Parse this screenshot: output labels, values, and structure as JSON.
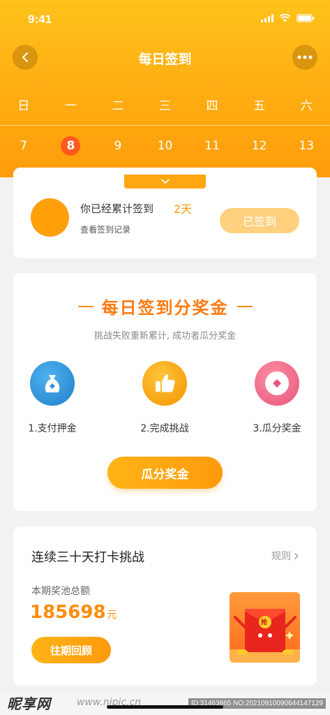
{
  "status_bar": {
    "time": "9:41"
  },
  "header": {
    "title": "每日签到",
    "weekdays": [
      "日",
      "一",
      "二",
      "三",
      "四",
      "五",
      "六"
    ],
    "dates": [
      "7",
      "8",
      "9",
      "10",
      "11",
      "12",
      "13"
    ],
    "today": "8"
  },
  "signin_card": {
    "label": "你已经累计签到",
    "days": "2天",
    "history_link": "查看签到记录",
    "signed_button": "已签到"
  },
  "promo_card": {
    "title": "每日签到分奖金",
    "subtitle": "挑战失败重新累计, 成功者瓜分奖金",
    "steps": [
      {
        "label": "1.支付押金",
        "icon": "money-bag-icon",
        "color": "#2f95dc"
      },
      {
        "label": "2.完成挑战",
        "icon": "thumbs-up-icon",
        "color": "#ffa010"
      },
      {
        "label": "3.瓜分奖金",
        "icon": "coin-icon",
        "color": "#f06a86"
      }
    ],
    "button": "瓜分奖金"
  },
  "challenge_card": {
    "title": "连续三十天打卡挑战",
    "rules_link": "规则",
    "pool_label": "本期奖池总额",
    "pool_amount": "185698",
    "pool_unit": "元",
    "history_button": "往期回顾",
    "red_packet_text": "抢"
  },
  "watermark": {
    "logo": "昵享网",
    "url": "www.nipic.cn",
    "id": "ID:31463865 NO:20210910090644147129"
  },
  "colors": {
    "brand": "#ffb014",
    "accent": "#ff7b12",
    "today": "#ff5a1f"
  }
}
